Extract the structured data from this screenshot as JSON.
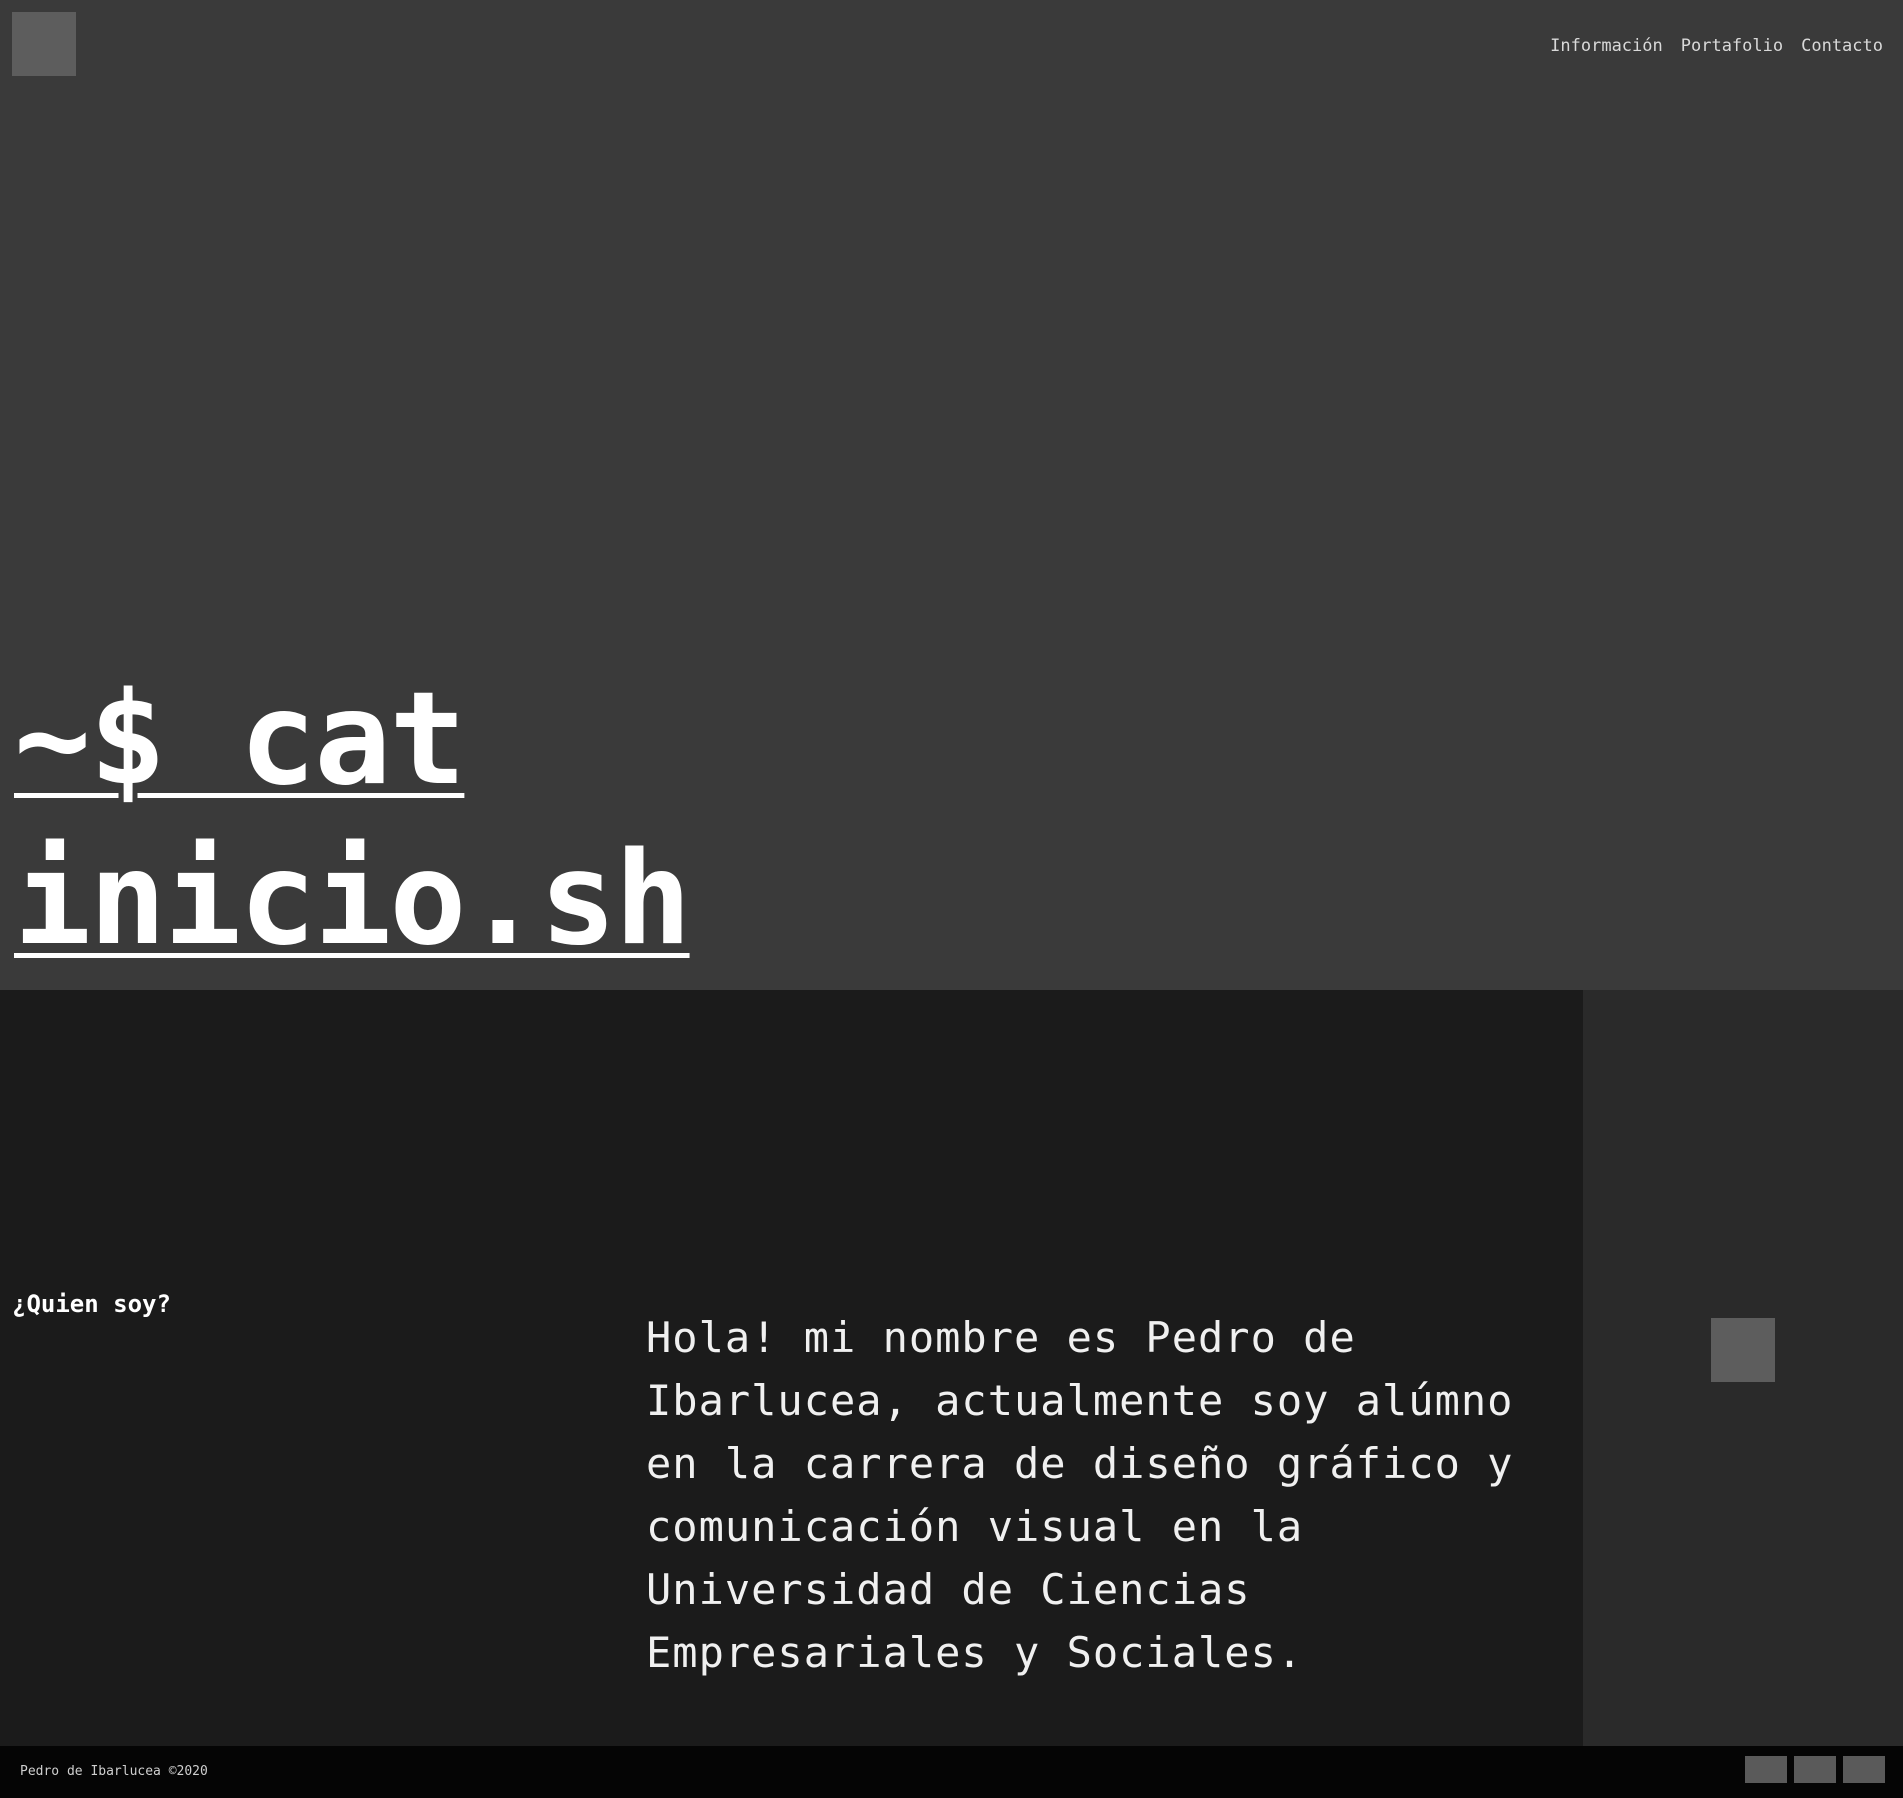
{
  "header": {
    "nav": [
      {
        "label": "Información"
      },
      {
        "label": "Portafolio"
      },
      {
        "label": "Contacto"
      }
    ]
  },
  "hero": {
    "line1": "~$ cat",
    "line2": "inicio.sh"
  },
  "about": {
    "heading": "¿Quien soy?",
    "text": "Hola! mi nombre es Pedro de Ibarlucea, actualmente soy alúmno en la carrera de diseño gráfico y comunicación visual en la Universidad de Ciencias Empresariales y Sociales."
  },
  "footer": {
    "copyright": "Pedro de Ibarlucea ©2020"
  },
  "colors": {
    "hero_bg": "#3a3a3a",
    "main_bg": "#1b1b1b",
    "aside_bg": "#2a2a2a",
    "footer_bg": "#050505",
    "placeholder": "#5d5d5d"
  }
}
